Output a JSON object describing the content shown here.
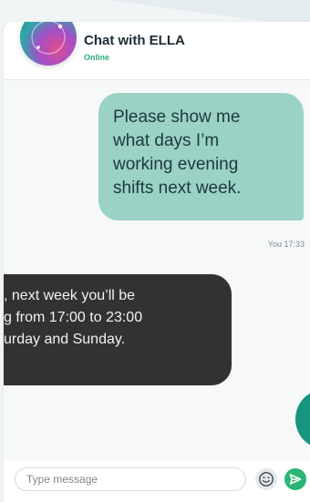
{
  "header": {
    "title": "Chat with ELLA",
    "status": "Online"
  },
  "messages": {
    "outgoing": {
      "text_lines": [
        "Please show me",
        "what days I’m",
        "working evening",
        "shifts next week."
      ],
      "sender": "You",
      "time": "17:33",
      "meta": "You 17:33"
    },
    "incoming": {
      "text_lines": [
        ", next week you’ll be",
        "g from 17:00 to 23:00",
        "urday and Sunday."
      ]
    }
  },
  "input": {
    "placeholder": "Type message"
  },
  "icons": {
    "avatar": "ella-avatar",
    "emoji": "smiley-icon",
    "send": "send-arrow-icon"
  },
  "colors": {
    "accent": "#2bb673",
    "outgoing_bubble": "#9ad2c6",
    "incoming_bubble": "#323233",
    "status_online": "#2cad75"
  }
}
